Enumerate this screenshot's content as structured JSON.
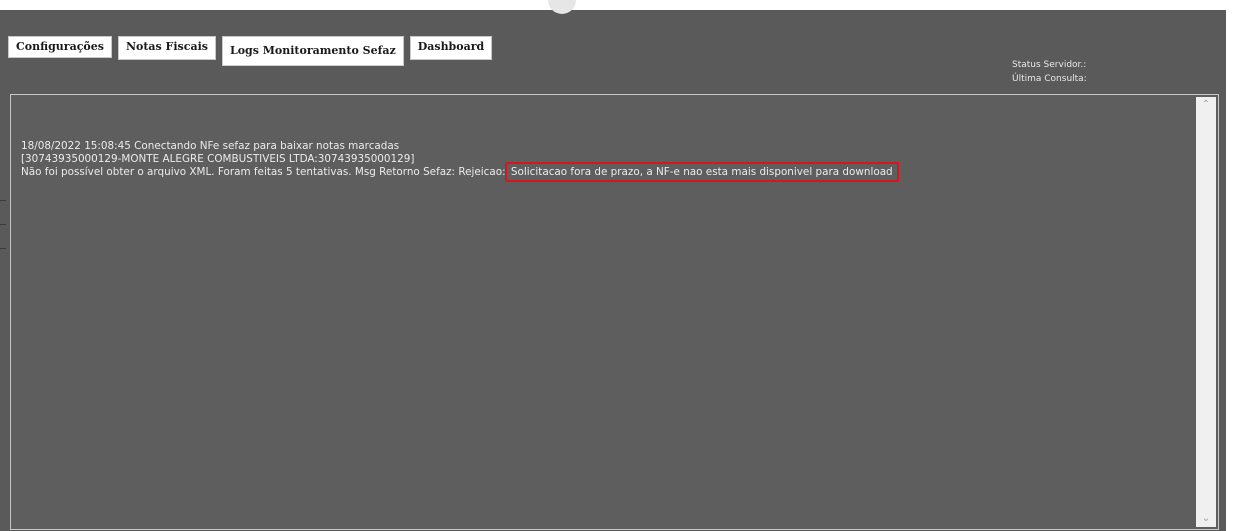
{
  "tabs": [
    {
      "label": "Configurações"
    },
    {
      "label": "Notas Fiscais"
    },
    {
      "label": "Logs Monitoramento Sefaz"
    },
    {
      "label": "Dashboard"
    }
  ],
  "status": {
    "servidor_label": "Status Servidor.:",
    "consulta_label": "Última Consulta:"
  },
  "log": {
    "line1": "18/08/2022 15:08:45 Conectando NFe sefaz para baixar notas marcadas",
    "line2": "[30743935000129-MONTE ALEGRE COMBUSTIVEIS LTDA:30743935000129]",
    "line3_prefix": "Não foi possível obter o arquivo XML. Foram feitas 5 tentativas. Msg Retorno Sefaz: Rejeicao: ",
    "line3_highlight": "Solicitacao fora de prazo, a NF-e nao esta mais disponivel para download"
  },
  "colors": {
    "app_background": "#5a5a5a",
    "log_text": "#ececec",
    "highlight_border": "#d6161d"
  },
  "icons": {
    "scroll_up": "chevron-up-icon",
    "scroll_down": "chevron-down-icon"
  }
}
